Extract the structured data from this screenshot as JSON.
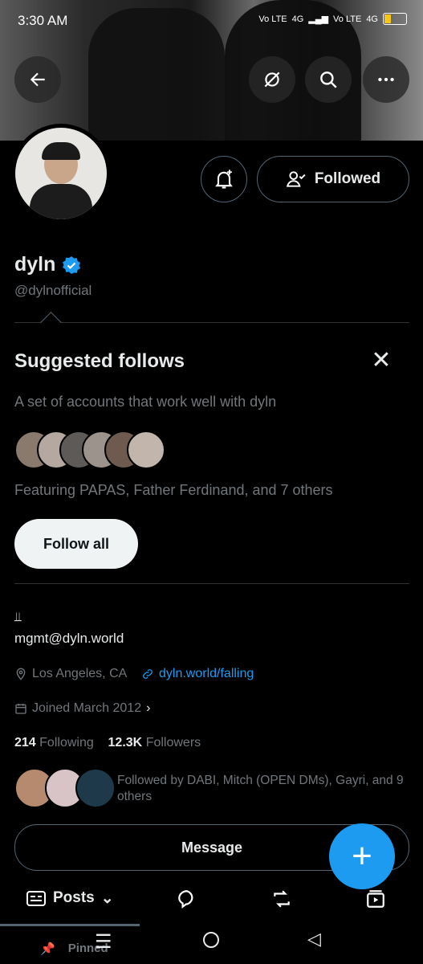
{
  "status": {
    "time": "3:30 AM",
    "net1": "Vo LTE",
    "net1b": "4G",
    "net2": "Vo LTE",
    "net2b": "4G"
  },
  "profile": {
    "name": "dyln",
    "handle": "@dylnofficial",
    "followed_label": "Followed",
    "bio_email": "mgmt@dyln.world",
    "location": "Los Angeles, CA",
    "website": "dyln.world/falling",
    "joined": "Joined March 2012",
    "following_count": "214",
    "following_label": "Following",
    "followers_count": "12.3K",
    "followers_label": "Followers",
    "followed_by": "Followed by DABI, Mitch (OPEN DMs), Gayri, and 9 others",
    "message_label": "Message"
  },
  "suggested": {
    "title": "Suggested follows",
    "subtitle": "A set of accounts that work well with dyln",
    "featuring": "Featuring PAPAS, Father Ferdinand, and 7 others",
    "follow_all": "Follow all"
  },
  "tabs": {
    "posts": "Posts",
    "pinned": "Pinned"
  },
  "colors": {
    "accent": "#1d9bf0",
    "background": "#000000",
    "muted": "#71767b"
  }
}
